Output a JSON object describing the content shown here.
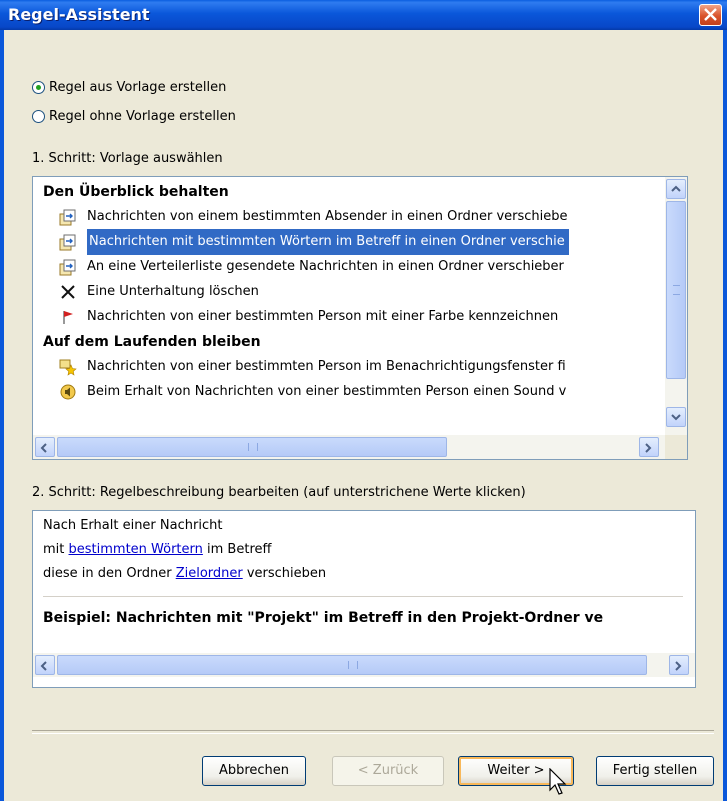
{
  "window": {
    "title": "Regel-Assistent"
  },
  "options": [
    {
      "label": "Regel aus Vorlage erstellen",
      "selected": true
    },
    {
      "label": "Regel ohne Vorlage erstellen",
      "selected": false
    }
  ],
  "step1": {
    "label": "1. Schritt: Vorlage auswählen",
    "groups": [
      {
        "title": "Den Überblick behalten",
        "items": [
          {
            "icon": "move-to-folder-icon",
            "label": "Nachrichten von einem bestimmten Absender in einen Ordner verschiebe",
            "selected": false
          },
          {
            "icon": "move-to-folder-icon",
            "label": "Nachrichten mit bestimmten Wörtern im Betreff in einen Ordner verschie",
            "selected": true
          },
          {
            "icon": "move-to-folder-icon",
            "label": "An eine Verteilerliste gesendete Nachrichten in einen Ordner verschieber",
            "selected": false
          },
          {
            "icon": "delete-x-icon",
            "label": "Eine Unterhaltung löschen",
            "selected": false
          },
          {
            "icon": "red-flag-icon",
            "label": "Nachrichten von einer bestimmten Person mit einer Farbe kennzeichnen",
            "selected": false
          }
        ]
      },
      {
        "title": "Auf dem Laufenden bleiben",
        "items": [
          {
            "icon": "alert-star-icon",
            "label": "Nachrichten von einer bestimmten Person im Benachrichtigungsfenster fi",
            "selected": false
          },
          {
            "icon": "sound-speaker-icon",
            "label": "Beim Erhalt von Nachrichten von einer bestimmten Person einen Sound v",
            "selected": false
          }
        ]
      }
    ]
  },
  "step2": {
    "label": "2. Schritt: Regelbeschreibung bearbeiten (auf unterstrichene Werte klicken)",
    "line1": "Nach Erhalt einer Nachricht",
    "line2_pre": "mit ",
    "line2_link": "bestimmten Wörtern",
    "line2_post": " im Betreff",
    "line3_pre": "diese in den Ordner ",
    "line3_link": "Zielordner",
    "line3_post": " verschieben",
    "example": "Beispiel: Nachrichten mit \"Projekt\" im Betreff in den Projekt-Ordner ve"
  },
  "buttons": {
    "cancel": "Abbrechen",
    "back": "< Zurück",
    "next": "Weiter >",
    "finish": "Fertig stellen"
  },
  "colors": {
    "titlebar": "#0A57DA",
    "selection": "#316AC5",
    "link": "#0000CC",
    "dialog_bg": "#ECE9D8"
  }
}
